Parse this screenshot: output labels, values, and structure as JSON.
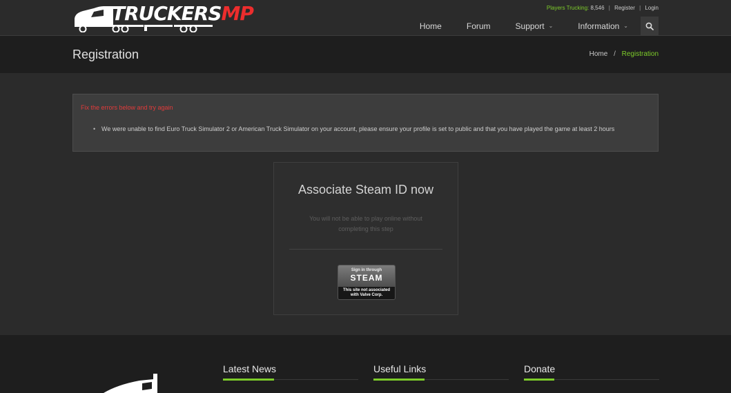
{
  "brand": {
    "name_part1": "TRUCKERS",
    "name_part2": "MP",
    "colors": {
      "accent_green": "#7dcc2a",
      "logo_red": "#ec2d2d",
      "error_red": "#e23b3b"
    }
  },
  "topbar": {
    "players_label": "Players Trucking:",
    "players_count": "8,546",
    "register": "Register",
    "login": "Login"
  },
  "nav": {
    "items": [
      {
        "label": "Home"
      },
      {
        "label": "Forum"
      },
      {
        "label": "Support"
      },
      {
        "label": "Information"
      }
    ],
    "search_icon": "search-icon",
    "dropdown_icon": "chevron-down-icon"
  },
  "page": {
    "title": "Registration",
    "breadcrumb": {
      "home": "Home",
      "current": "Registration"
    }
  },
  "error": {
    "title": "Fix the errors below and try again",
    "messages": [
      "We were unable to find Euro Truck Simulator 2 or American Truck Simulator on your account, please ensure your profile is set to public and that you have played the game at least 2 hours"
    ]
  },
  "steam_card": {
    "title": "Associate Steam ID now",
    "description": "You will not be able to play online without completing this step",
    "button": {
      "line1": "Sign in through",
      "line2": "STEAM",
      "line3": "This site not associated",
      "line4": "with Valve Corp."
    }
  },
  "footer": {
    "columns": [
      {
        "heading": "Latest News"
      },
      {
        "heading": "Useful Links"
      },
      {
        "heading": "Donate"
      }
    ]
  }
}
